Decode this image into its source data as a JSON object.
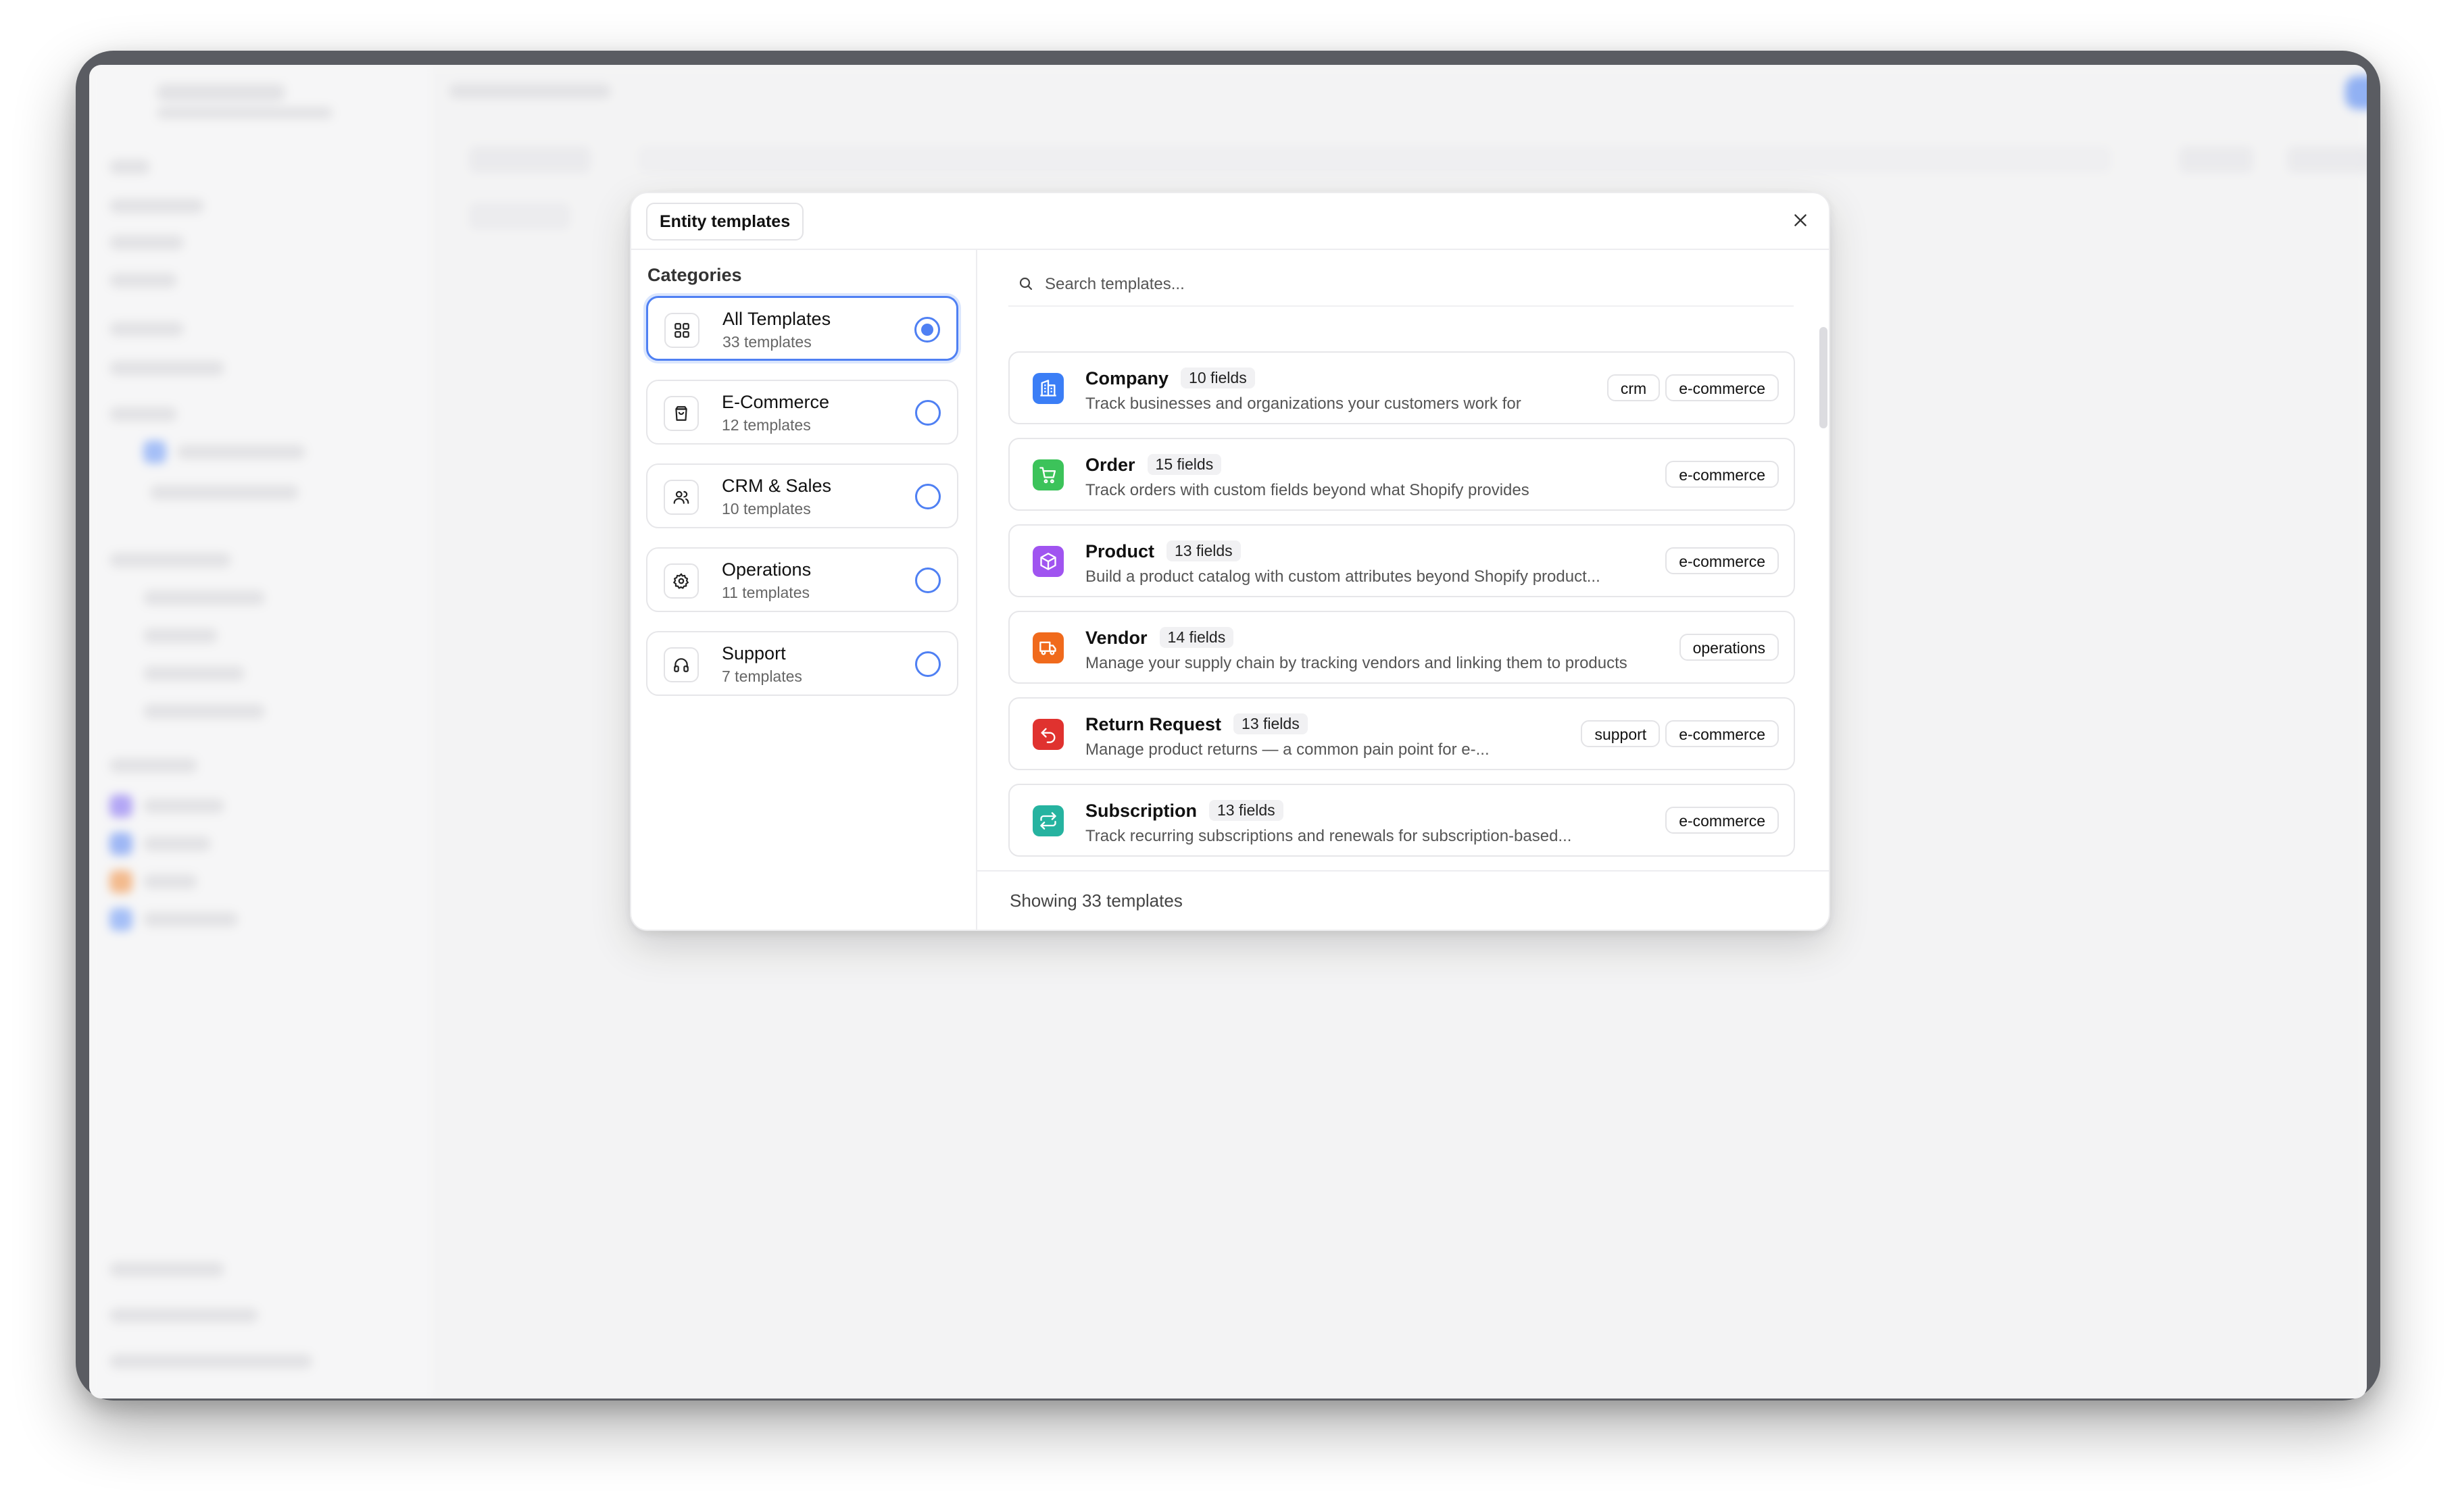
{
  "modal": {
    "title": "Entity templates",
    "close_icon": "close-icon"
  },
  "categories": {
    "heading": "Categories",
    "items": [
      {
        "name": "All Templates",
        "count": "33 templates",
        "icon": "grid-icon",
        "selected": true
      },
      {
        "name": "E-Commerce",
        "count": "12 templates",
        "icon": "shopping-bag-icon",
        "selected": false
      },
      {
        "name": "CRM & Sales",
        "count": "10 templates",
        "icon": "users-icon",
        "selected": false
      },
      {
        "name": "Operations",
        "count": "11 templates",
        "icon": "gear-icon",
        "selected": false
      },
      {
        "name": "Support",
        "count": "7 templates",
        "icon": "headphones-icon",
        "selected": false
      }
    ]
  },
  "search": {
    "placeholder": "Search templates..."
  },
  "templates": [
    {
      "name": "Company",
      "fields": "10 fields",
      "description": "Track businesses and organizations your customers work for",
      "tags": [
        "crm",
        "e-commerce"
      ],
      "icon": "building-icon",
      "color": "#3b7ef6"
    },
    {
      "name": "Order",
      "fields": "15 fields",
      "description": "Track orders with custom fields beyond what Shopify provides",
      "tags": [
        "e-commerce"
      ],
      "icon": "cart-icon",
      "color": "#3cc35a"
    },
    {
      "name": "Product",
      "fields": "13 fields",
      "description": "Build a product catalog with custom attributes beyond Shopify product...",
      "tags": [
        "e-commerce"
      ],
      "icon": "package-icon",
      "color": "#a054f0"
    },
    {
      "name": "Vendor",
      "fields": "14 fields",
      "description": "Manage your supply chain by tracking vendors and linking them to products",
      "tags": [
        "operations"
      ],
      "icon": "truck-icon",
      "color": "#f06a1c"
    },
    {
      "name": "Return Request",
      "fields": "13 fields",
      "description": "Manage product returns — a common pain point for e-...",
      "tags": [
        "support",
        "e-commerce"
      ],
      "icon": "undo-icon",
      "color": "#e0322f"
    },
    {
      "name": "Subscription",
      "fields": "13 fields",
      "description": "Track recurring subscriptions and renewals for subscription-based...",
      "tags": [
        "e-commerce"
      ],
      "icon": "repeat-icon",
      "color": "#26b3a0"
    }
  ],
  "footer": {
    "showing": "Showing 33 templates"
  },
  "colors": {
    "accent": "#4f80f3"
  }
}
